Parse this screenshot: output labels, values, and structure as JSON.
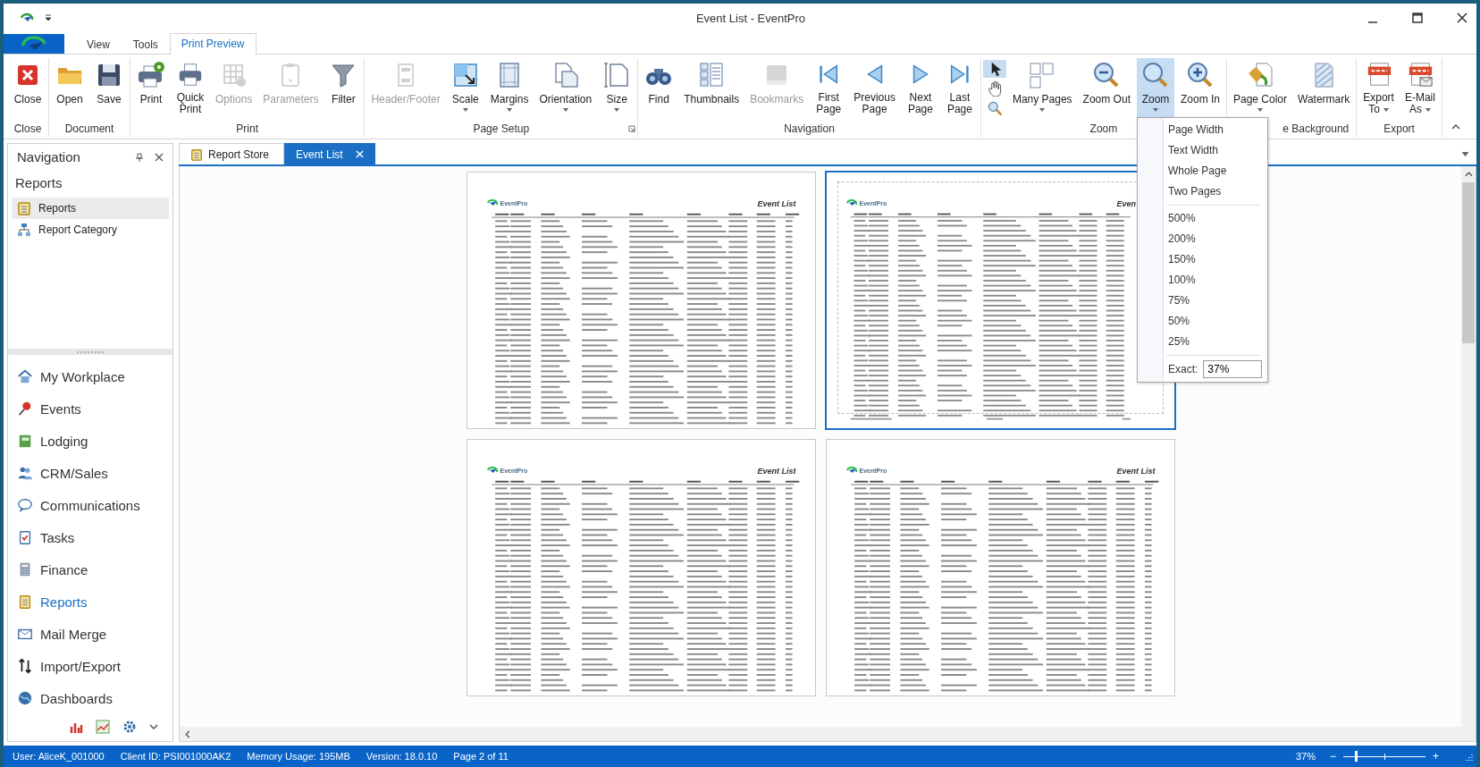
{
  "window": {
    "title": "Event List - EventPro"
  },
  "ribbon_tabs": [
    {
      "label": "View",
      "selected": false
    },
    {
      "label": "Tools",
      "selected": false
    },
    {
      "label": "Print Preview",
      "selected": true
    }
  ],
  "ribbon_groups": [
    {
      "label": "Close",
      "buttons": [
        {
          "label": "Close",
          "disabled": false,
          "selected": false
        }
      ]
    },
    {
      "label": "Document",
      "buttons": [
        {
          "label": "Open",
          "disabled": false,
          "selected": false
        },
        {
          "label": "Save",
          "disabled": false,
          "selected": false
        }
      ]
    },
    {
      "label": "Print",
      "buttons": [
        {
          "label": "Print",
          "disabled": false,
          "selected": false
        },
        {
          "label": "Quick\nPrint",
          "disabled": false,
          "selected": false
        },
        {
          "label": "Options",
          "disabled": true,
          "selected": false
        },
        {
          "label": "Parameters",
          "disabled": true,
          "selected": false
        },
        {
          "label": "Filter",
          "disabled": false,
          "selected": false
        }
      ]
    },
    {
      "label": "Page Setup",
      "launcher": true,
      "buttons": [
        {
          "label": "Header/Footer",
          "disabled": true,
          "selected": false
        },
        {
          "label": "Scale",
          "disabled": false,
          "selected": false,
          "dropdown": true
        },
        {
          "label": "Margins",
          "disabled": false,
          "selected": false,
          "dropdown": true
        },
        {
          "label": "Orientation",
          "disabled": false,
          "selected": false,
          "dropdown": true
        },
        {
          "label": "Size",
          "disabled": false,
          "selected": false,
          "dropdown": true
        }
      ]
    },
    {
      "label": "Navigation",
      "buttons": [
        {
          "label": "Find",
          "disabled": false,
          "selected": false
        },
        {
          "label": "Thumbnails",
          "disabled": false,
          "selected": false
        },
        {
          "label": "Bookmarks",
          "disabled": true,
          "selected": false
        },
        {
          "label": "First\nPage",
          "disabled": false,
          "selected": false
        },
        {
          "label": "Previous\nPage",
          "disabled": false,
          "selected": false
        },
        {
          "label": "Next\nPage",
          "disabled": false,
          "selected": false
        },
        {
          "label": "Last\nPage",
          "disabled": false,
          "selected": false
        }
      ]
    },
    {
      "label": "Zoom",
      "tools": [
        {
          "selected": true
        },
        {
          "selected": false
        },
        {
          "selected": false
        }
      ],
      "buttons": [
        {
          "label": "Many Pages",
          "disabled": false,
          "selected": false,
          "dropdown": true
        },
        {
          "label": "Zoom Out",
          "disabled": false,
          "selected": false
        },
        {
          "label": "Zoom",
          "disabled": false,
          "selected": true,
          "dropdown": true
        },
        {
          "label": "Zoom In",
          "disabled": false,
          "selected": false
        }
      ]
    },
    {
      "label": "e Background",
      "buttons": [
        {
          "label": "Page Color",
          "disabled": false,
          "selected": false,
          "dropdown": true
        },
        {
          "label": "Watermark",
          "disabled": false,
          "selected": false
        }
      ]
    },
    {
      "label": "Export",
      "buttons": [
        {
          "label": "Export\nTo",
          "disabled": false,
          "selected": false,
          "dropdown": true,
          "caret_inline": true
        },
        {
          "label": "E-Mail\nAs",
          "disabled": false,
          "selected": false,
          "dropdown": true,
          "caret_inline": true
        }
      ]
    }
  ],
  "zoom_menu": {
    "items": [
      {
        "kind": "item",
        "label": "Page Width"
      },
      {
        "kind": "item",
        "label": "Text Width"
      },
      {
        "kind": "item",
        "label": "Whole Page"
      },
      {
        "kind": "item",
        "label": "Two Pages"
      },
      {
        "kind": "separator"
      },
      {
        "kind": "item",
        "label": "500%"
      },
      {
        "kind": "item",
        "label": "200%"
      },
      {
        "kind": "item",
        "label": "150%"
      },
      {
        "kind": "item",
        "label": "100%"
      },
      {
        "kind": "item",
        "label": "75%"
      },
      {
        "kind": "item",
        "label": "50%"
      },
      {
        "kind": "item",
        "label": "25%"
      },
      {
        "kind": "separator"
      }
    ],
    "exact": {
      "label": "Exact:",
      "value": "37%"
    }
  },
  "navigation": {
    "title": "Navigation",
    "section": "Reports",
    "items": [
      {
        "label": "Reports",
        "selected": true
      },
      {
        "label": "Report Category",
        "selected": false
      }
    ],
    "modules": [
      {
        "label": "My Workplace",
        "selected": false
      },
      {
        "label": "Events",
        "selected": false
      },
      {
        "label": "Lodging",
        "selected": false
      },
      {
        "label": "CRM/Sales",
        "selected": false
      },
      {
        "label": "Communications",
        "selected": false
      },
      {
        "label": "Tasks",
        "selected": false
      },
      {
        "label": "Finance",
        "selected": false
      },
      {
        "label": "Reports",
        "selected": true
      },
      {
        "label": "Mail Merge",
        "selected": false
      },
      {
        "label": "Import/Export",
        "selected": false
      },
      {
        "label": "Dashboards",
        "selected": false
      }
    ]
  },
  "doc_tabs": [
    {
      "label": "Report Store",
      "selected": false,
      "closable": false
    },
    {
      "label": "Event List",
      "selected": true,
      "closable": true
    }
  ],
  "pages": [
    {
      "logo_text": "EventPro",
      "title": "Event List",
      "selected": false
    },
    {
      "logo_text": "EventPro",
      "title": "Even",
      "selected": true
    },
    {
      "logo_text": "EventPro",
      "title": "Event List",
      "selected": false
    },
    {
      "logo_text": "EventPro",
      "title": "Event List",
      "selected": false
    }
  ],
  "status_bar": {
    "items": [
      "User: AliceK_001000",
      "Client ID: PSI001000AK2",
      "Memory Usage: 195MB",
      "Version: 18.0.10",
      "Page 2 of 11"
    ],
    "zoom": "37%",
    "minus": "−",
    "plus": "+",
    "level": 0.15
  }
}
